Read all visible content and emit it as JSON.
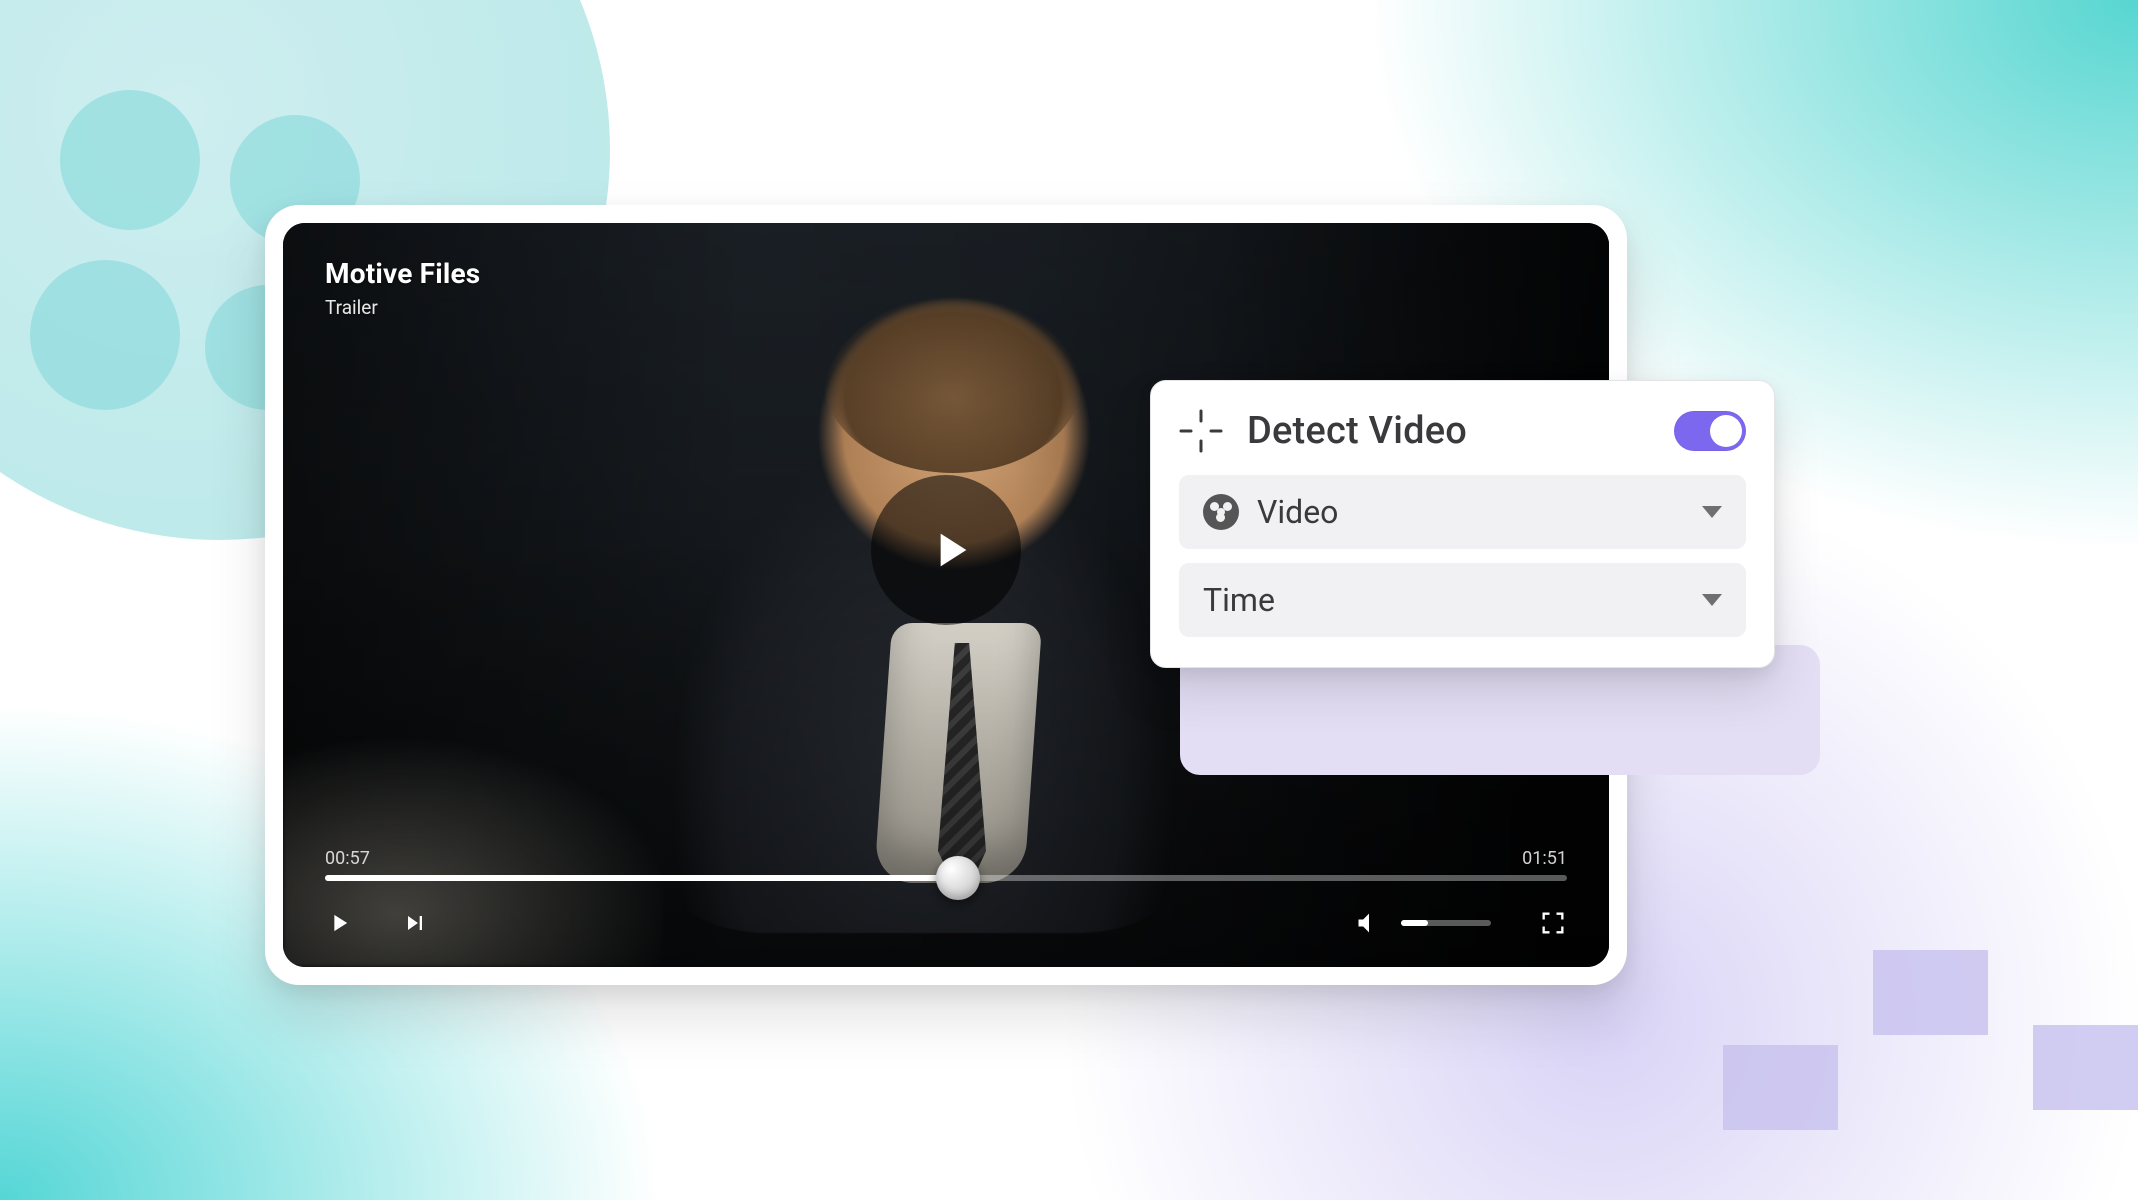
{
  "video": {
    "title": "Motive Files",
    "subtitle": "Trailer",
    "current_time": "00:57",
    "duration": "01:51",
    "progress_percent": 51,
    "volume_percent": 30
  },
  "popover": {
    "title": "Detect Video",
    "toggle_on": true,
    "rows": [
      {
        "icon": "film-reel-icon",
        "label": "Video"
      },
      {
        "icon": null,
        "label": "Time"
      }
    ]
  },
  "colors": {
    "accent": "#7b68ee",
    "row_bg": "#f1f1f3",
    "text": "#3a3a3d"
  }
}
